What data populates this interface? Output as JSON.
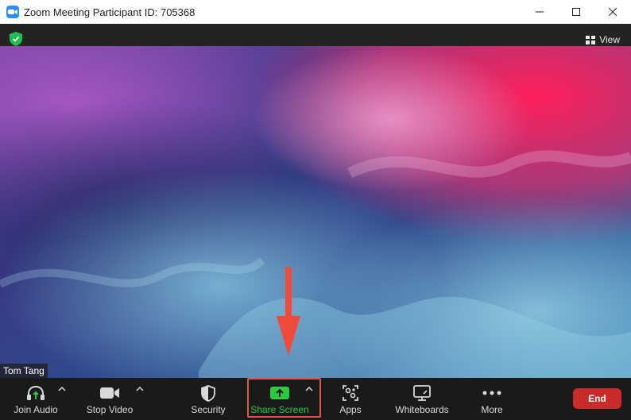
{
  "window": {
    "title": "Zoom Meeting Participant ID: 705368"
  },
  "topbar": {
    "view_label": "View"
  },
  "video": {
    "participant_name": "Tom Tang"
  },
  "toolbar": {
    "join_audio": "Join Audio",
    "stop_video": "Stop Video",
    "security": "Security",
    "share_screen": "Share Screen",
    "apps": "Apps",
    "whiteboards": "Whiteboards",
    "more": "More",
    "end": "End"
  },
  "colors": {
    "share_green": "#2dca3f",
    "end_red": "#c92b2b",
    "highlight_red": "#e5534b",
    "shield_green": "#1fbf4f"
  }
}
